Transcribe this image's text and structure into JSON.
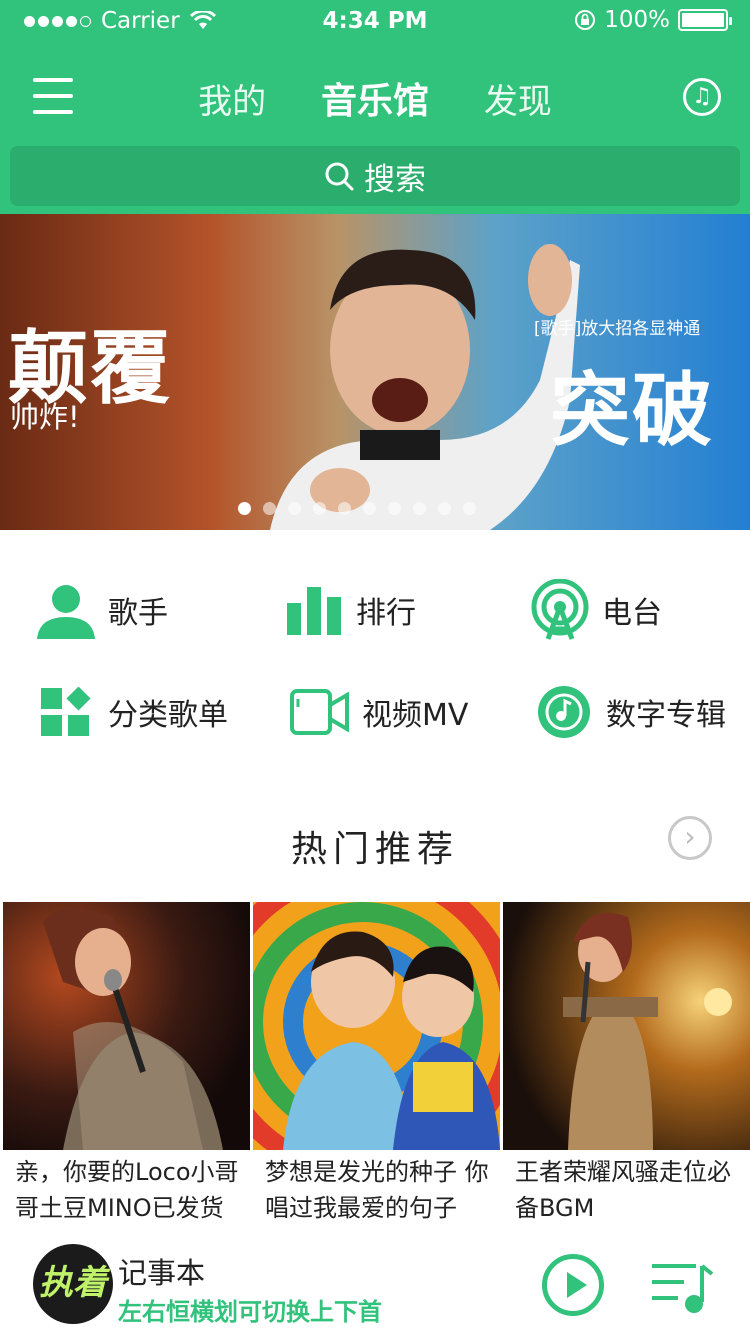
{
  "status_bar": {
    "carrier": "Carrier",
    "time": "4:34 PM",
    "battery": "100%"
  },
  "nav": {
    "tabs": [
      {
        "label": "我的",
        "active": false
      },
      {
        "label": "音乐馆",
        "active": true
      },
      {
        "label": "发现",
        "active": false
      }
    ]
  },
  "search": {
    "placeholder": "搜索"
  },
  "banner": {
    "left_title": "颠覆",
    "left_subtitle": "帅炸!",
    "right_small": "[歌手]放大招各显神通",
    "right_title": "突破",
    "dot_count": 10,
    "active_dot": 0
  },
  "categories": [
    {
      "label": "歌手",
      "icon": "singer-icon"
    },
    {
      "label": "排行",
      "icon": "rank-icon"
    },
    {
      "label": "电台",
      "icon": "radio-icon"
    },
    {
      "label": "分类歌单",
      "icon": "category-playlist-icon"
    },
    {
      "label": "视频MV",
      "icon": "video-mv-icon"
    },
    {
      "label": "数字专辑",
      "icon": "digital-album-icon"
    }
  ],
  "hot": {
    "title": "热门推荐",
    "cards": [
      {
        "caption": "亲，你要的Loco小哥哥土豆MINO已发货"
      },
      {
        "caption": "梦想是发光的种子 你唱过我最爱的句子"
      },
      {
        "caption": "王者荣耀风骚走位必备BGM"
      }
    ]
  },
  "player": {
    "album_text": "执着",
    "title": "记事本",
    "subtitle": "左右恒横划可切换上下首"
  },
  "colors": {
    "brand_green": "#31c27c",
    "search_bg": "#2aad6d"
  }
}
